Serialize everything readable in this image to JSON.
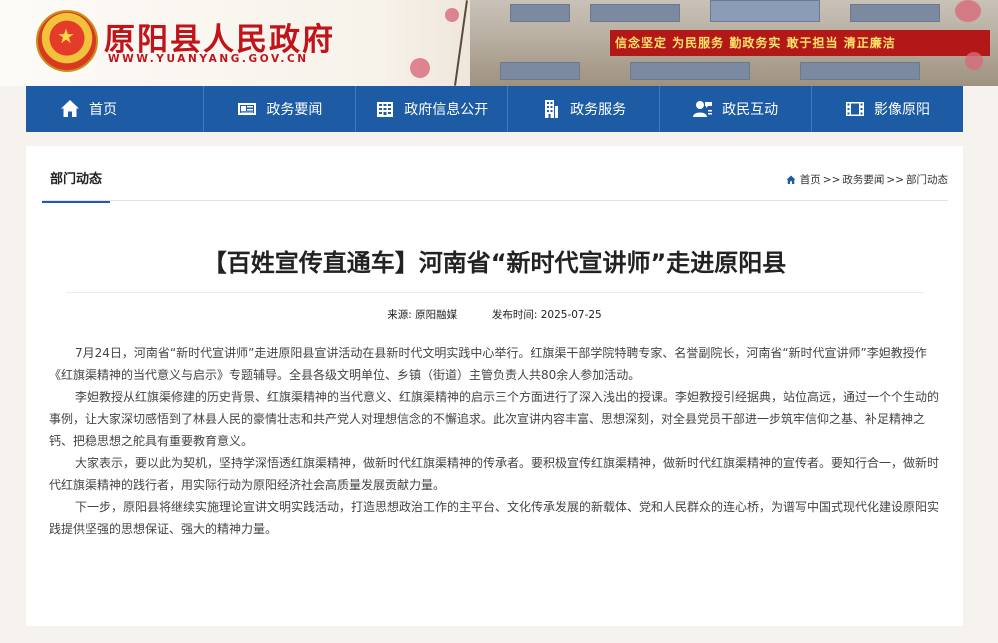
{
  "header": {
    "site_title": "原阳县人民政府",
    "site_url": "WWW.YUANYANG.GOV.CN",
    "slogan": "信念坚定  为民服务  勤政务实  敢于担当  清正廉洁"
  },
  "nav": {
    "items": [
      {
        "label": "首页",
        "icon": "home-icon"
      },
      {
        "label": "政务要闻",
        "icon": "news-icon"
      },
      {
        "label": "政府信息公开",
        "icon": "building-info-icon"
      },
      {
        "label": "政务服务",
        "icon": "office-building-icon"
      },
      {
        "label": "政民互动",
        "icon": "user-chat-icon"
      },
      {
        "label": "影像原阳",
        "icon": "film-icon"
      }
    ]
  },
  "section": {
    "tab_label": "部门动态",
    "breadcrumb": [
      "首页",
      ">>",
      "政务要闻",
      ">>",
      "部门动态"
    ]
  },
  "article": {
    "title": "【百姓宣传直通车】河南省“新时代宣讲师”走进原阳县",
    "source_label": "来源:",
    "source_value": "原阳融媒",
    "date_label": "发布时间:",
    "date_value": "2025-07-25",
    "paragraphs": [
      "7月24日，河南省“新时代宣讲师”走进原阳县宣讲活动在县新时代文明实践中心举行。红旗渠干部学院特聘专家、名誉副院长，河南省“新时代宣讲师”李妲教授作《红旗渠精神的当代意义与启示》专题辅导。全县各级文明单位、乡镇（街道）主管负责人共80余人参加活动。",
      "李妲教授从红旗渠修建的历史背景、红旗渠精神的当代意义、红旗渠精神的启示三个方面进行了深入浅出的授课。李妲教授引经据典，站位高远，通过一个个生动的事例，让大家深切感悟到了林县人民的豪情壮志和共产党人对理想信念的不懈追求。此次宣讲内容丰富、思想深刻，对全县党员干部进一步筑牢信仰之基、补足精神之钙、把稳思想之舵具有重要教育意义。",
      "大家表示，要以此为契机，坚持学深悟透红旗渠精神，做新时代红旗渠精神的传承者。要积极宣传红旗渠精神，做新时代红旗渠精神的宣传者。要知行合一，做新时代红旗渠精神的践行者，用实际行动为原阳经济社会高质量发展贡献力量。",
      "下一步，原阳县将继续实施理论宣讲文明实践活动，打造思想政治工作的主平台、文化传承发展的新载体、党和人民群众的连心桥，为谱写中国式现代化建设原阳实践提供坚强的思想保证、强大的精神力量。"
    ]
  }
}
